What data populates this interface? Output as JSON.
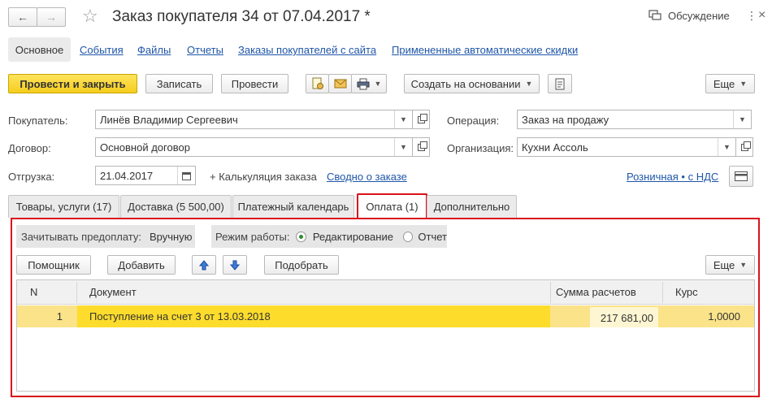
{
  "window": {
    "title": "Заказ покупателя 34 от 07.04.2017 *",
    "discussion_label": "Обсуждение"
  },
  "nav_tabs": [
    {
      "label": "Основное",
      "active": true
    },
    {
      "label": "События"
    },
    {
      "label": "Файлы"
    },
    {
      "label": "Отчеты"
    },
    {
      "label": "Заказы покупателей с сайта"
    },
    {
      "label": "Примененные автоматические скидки"
    }
  ],
  "toolbar": {
    "post_close": "Провести и закрыть",
    "save": "Записать",
    "post": "Провести",
    "create_based": "Создать на основании",
    "more": "Еще"
  },
  "form": {
    "buyer_label": "Покупатель:",
    "buyer_value": "Линёв Владимир Сергеевич",
    "contract_label": "Договор:",
    "contract_value": "Основной договор",
    "shipment_label": "Отгрузка:",
    "shipment_value": "21.04.2017",
    "calc_label": "+ Калькуляция заказа",
    "summary_link": "Сводно о заказе",
    "operation_label": "Операция:",
    "operation_value": "Заказ на продажу",
    "org_label": "Организация:",
    "org_value": "Кухни Ассоль",
    "price_link": "Розничная • с НДС"
  },
  "doc_tabs": [
    {
      "label": "Товары, услуги (17)"
    },
    {
      "label": "Доставка (5 500,00)"
    },
    {
      "label": "Платежный календарь"
    },
    {
      "label": "Оплата (1)",
      "active": true
    },
    {
      "label": "Дополнительно"
    }
  ],
  "payment": {
    "prepay_label": "Зачитывать предоплату:",
    "prepay_value": "Вручную",
    "mode_label": "Режим работы:",
    "mode_edit": "Редактирование",
    "mode_report": "Отчет",
    "assistant": "Помощник",
    "add": "Добавить",
    "pick": "Подобрать",
    "more": "Еще"
  },
  "table": {
    "headers": [
      "N",
      "Документ",
      "Сумма расчетов",
      "Курс"
    ],
    "rows": [
      {
        "n": "1",
        "doc": "Поступление на счет 3 от 13.03.2018",
        "sum": "217 681,00",
        "rate": "1,0000"
      }
    ]
  },
  "colors": {
    "accent_yellow": "#f5cd1f",
    "selection_row": "#fbe38a",
    "highlight_red": "#d9121b",
    "link_blue": "#1f56a8"
  }
}
